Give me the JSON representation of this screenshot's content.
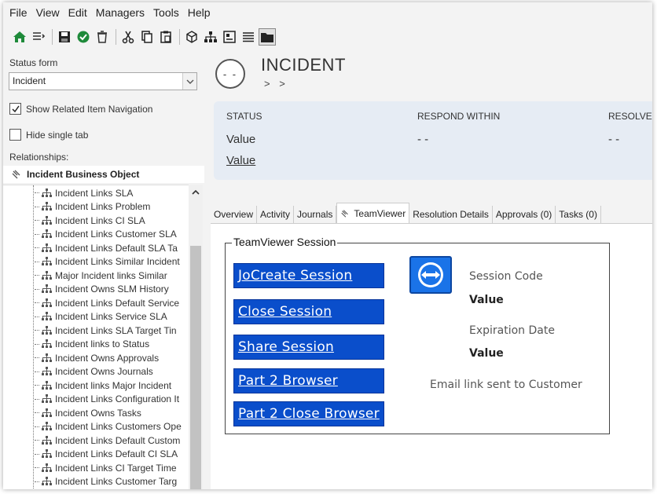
{
  "menu": [
    "File",
    "View",
    "Edit",
    "Managers",
    "Tools",
    "Help"
  ],
  "toolbar": {
    "icons": [
      "home-icon",
      "list-icon",
      "save-icon",
      "checkmark-icon",
      "trash-icon",
      "cut-icon",
      "copy-icon",
      "paste-icon",
      "cube-icon",
      "hierarchy-icon",
      "form-icon",
      "lines-icon",
      "folder-icon"
    ]
  },
  "left": {
    "status_form_label": "Status form",
    "status_form_value": "Incident",
    "show_related_label": "Show Related Item Navigation",
    "show_related_checked": true,
    "hide_single_tab_label": "Hide single tab",
    "hide_single_tab_checked": false,
    "relationships_label": "Relationships:",
    "root_item": "Incident Business Object",
    "tree_items": [
      "Incident Links SLA",
      "Incident Links Problem",
      "Incident Links CI SLA",
      "Incident Links Customer SLA",
      "Incident Links Default SLA Ta",
      "Incident Links Similar Incident",
      "Major Incident links Similar",
      "Incident Owns SLM History",
      "Incident Links Default Service",
      "Incident Links Service SLA",
      "Incident Links SLA Target Tin",
      "Incident links to Status",
      "Incident Owns Approvals",
      "Incident Owns Journals",
      "Incident links Major Incident",
      "Incident Links Configuration It",
      "Incident Owns Tasks",
      "Incident Links Customers Ope",
      "Incident Links Default Custom",
      "Incident Links Default CI SLA",
      "Incident Links CI Target Time",
      "Incident Links Customer Targ"
    ]
  },
  "header": {
    "avatar_text": "- -",
    "title": "INCIDENT",
    "breadcrumb": "> >"
  },
  "status_panel": {
    "status_header": "STATUS",
    "respond_header": "RESPOND WITHIN",
    "resolve_header": "RESOLVE",
    "status_value": "Value",
    "status_link": "Value",
    "respond_value": "- -",
    "resolve_value": "- -"
  },
  "tabs": [
    "Overview",
    "Activity",
    "Journals",
    "TeamViewer",
    "Resolution Details",
    "Approvals (0)",
    "Tasks (0)"
  ],
  "active_tab": "TeamViewer",
  "teamviewer": {
    "legend": "TeamViewer Session",
    "buttons": [
      "JoCreate Session",
      "Close Session",
      "Share Session",
      "Part 2 Browser",
      "Part 2 Close Browser"
    ],
    "session_code_label": "Session Code",
    "session_code_value": "Value",
    "expiration_label": "Expiration Date",
    "expiration_value": "Value",
    "email_text": "Email link sent to Customer"
  },
  "colors": {
    "button_blue": "#0a4ecb",
    "status_panel_bg": "#e6ecf4",
    "teamviewer_blue": "#1a73e8"
  }
}
